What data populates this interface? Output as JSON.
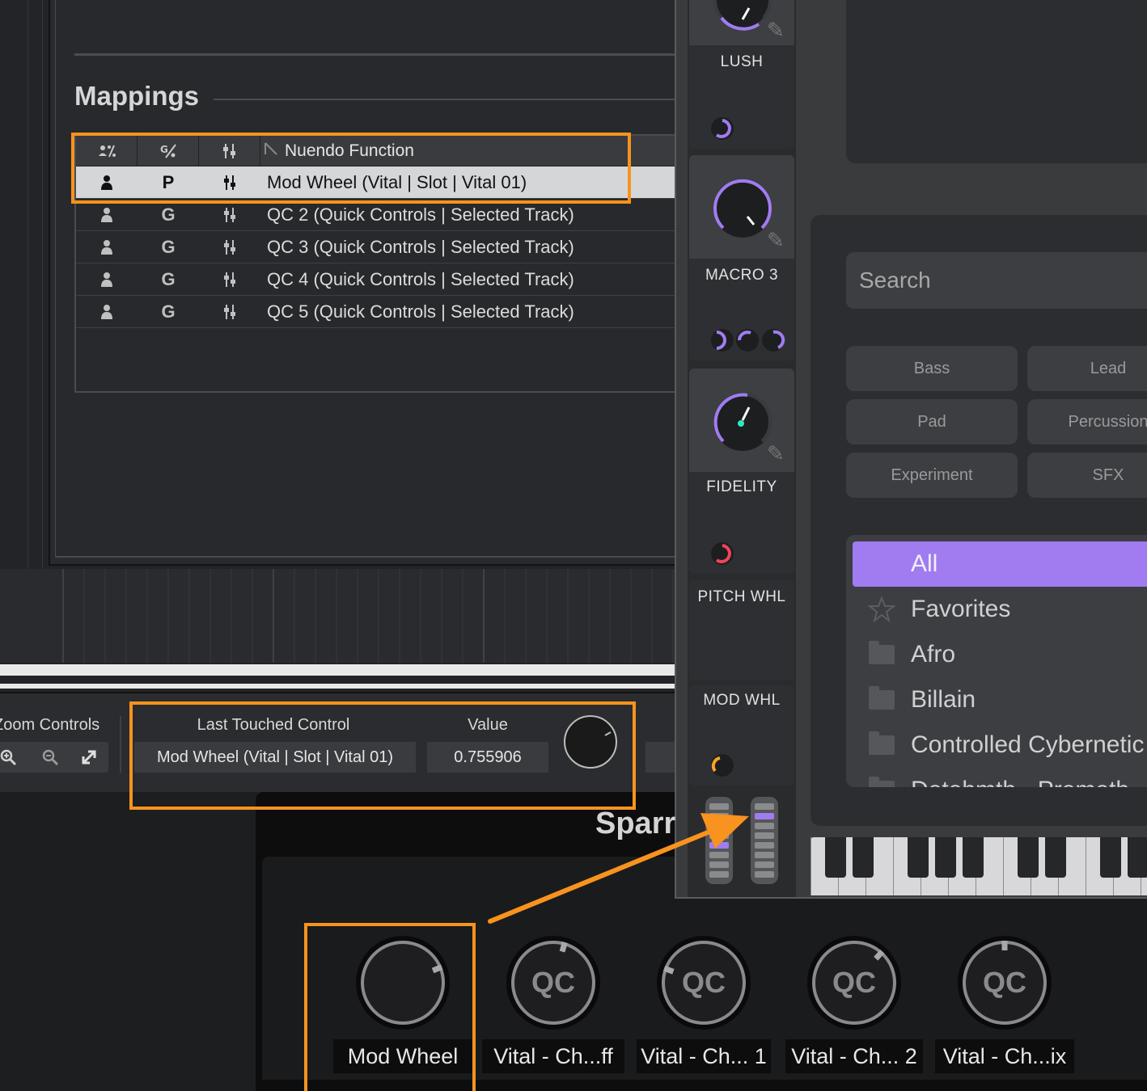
{
  "mappings": {
    "title": "Mappings",
    "header": {
      "col1_icon": "user-percent-icon",
      "col2_icon": "global-percent-icon",
      "col3_icon": "mixer-icon",
      "function_label": "Nuendo Function"
    },
    "rows": [
      {
        "scope_icon": "user-icon",
        "type": "P",
        "mode_icon": "mixer-icon",
        "function": "Mod Wheel (Vital | Slot | Vital 01)",
        "selected": true
      },
      {
        "scope_icon": "user-icon",
        "type": "G",
        "mode_icon": "mixer-icon",
        "function": "QC 2 (Quick Controls | Selected Track)",
        "selected": false
      },
      {
        "scope_icon": "user-icon",
        "type": "G",
        "mode_icon": "mixer-icon",
        "function": "QC 3 (Quick Controls | Selected Track)",
        "selected": false
      },
      {
        "scope_icon": "user-icon",
        "type": "G",
        "mode_icon": "mixer-icon",
        "function": "QC 4 (Quick Controls | Selected Track)",
        "selected": false
      },
      {
        "scope_icon": "user-icon",
        "type": "G",
        "mode_icon": "mixer-icon",
        "function": "QC 5 (Quick Controls | Selected Track)",
        "selected": false
      }
    ]
  },
  "status_strip": {
    "zoom_label": "Zoom Controls",
    "last_touched_label": "Last Touched Control",
    "last_touched_value": "Mod Wheel (Vital | Slot | Vital 01)",
    "value_label": "Value",
    "value": "0.755906"
  },
  "remote": {
    "title": "Sparr",
    "knobs": [
      {
        "label": "Mod Wheel",
        "text": ""
      },
      {
        "label": "Vital - Ch...ff",
        "text": "QC"
      },
      {
        "label": "Vital - Ch... 1",
        "text": "QC"
      },
      {
        "label": "Vital - Ch... 2",
        "text": "QC"
      },
      {
        "label": "Vital - Ch...ix",
        "text": "QC"
      }
    ]
  },
  "macros": [
    {
      "name": "LUSH"
    },
    {
      "name": "MACRO 3"
    },
    {
      "name": "FIDELITY"
    },
    {
      "name": "PITCH WHL"
    },
    {
      "name": "MOD WHL"
    }
  ],
  "browser": {
    "search_placeholder": "Search",
    "categories": [
      "Bass",
      "Lead",
      "Pad",
      "Percussion",
      "Experiment",
      "SFX"
    ],
    "list": [
      {
        "label": "All",
        "icon": "",
        "active": true
      },
      {
        "label": "Favorites",
        "icon": "star-icon",
        "active": false
      },
      {
        "label": "Afro",
        "icon": "folder-icon",
        "active": false
      },
      {
        "label": "Billain",
        "icon": "folder-icon",
        "active": false
      },
      {
        "label": "Controlled Cybernetic",
        "icon": "folder-icon",
        "active": false
      },
      {
        "label": "Dotohmth - Prometh",
        "icon": "folder-icon",
        "active": false
      }
    ]
  },
  "colors": {
    "accent_purple": "#a07cf0",
    "highlight_orange": "#f7931e",
    "knob_teal": "#2ee8c8",
    "knob_red": "#f0445a",
    "knob_orange": "#f5a623"
  }
}
